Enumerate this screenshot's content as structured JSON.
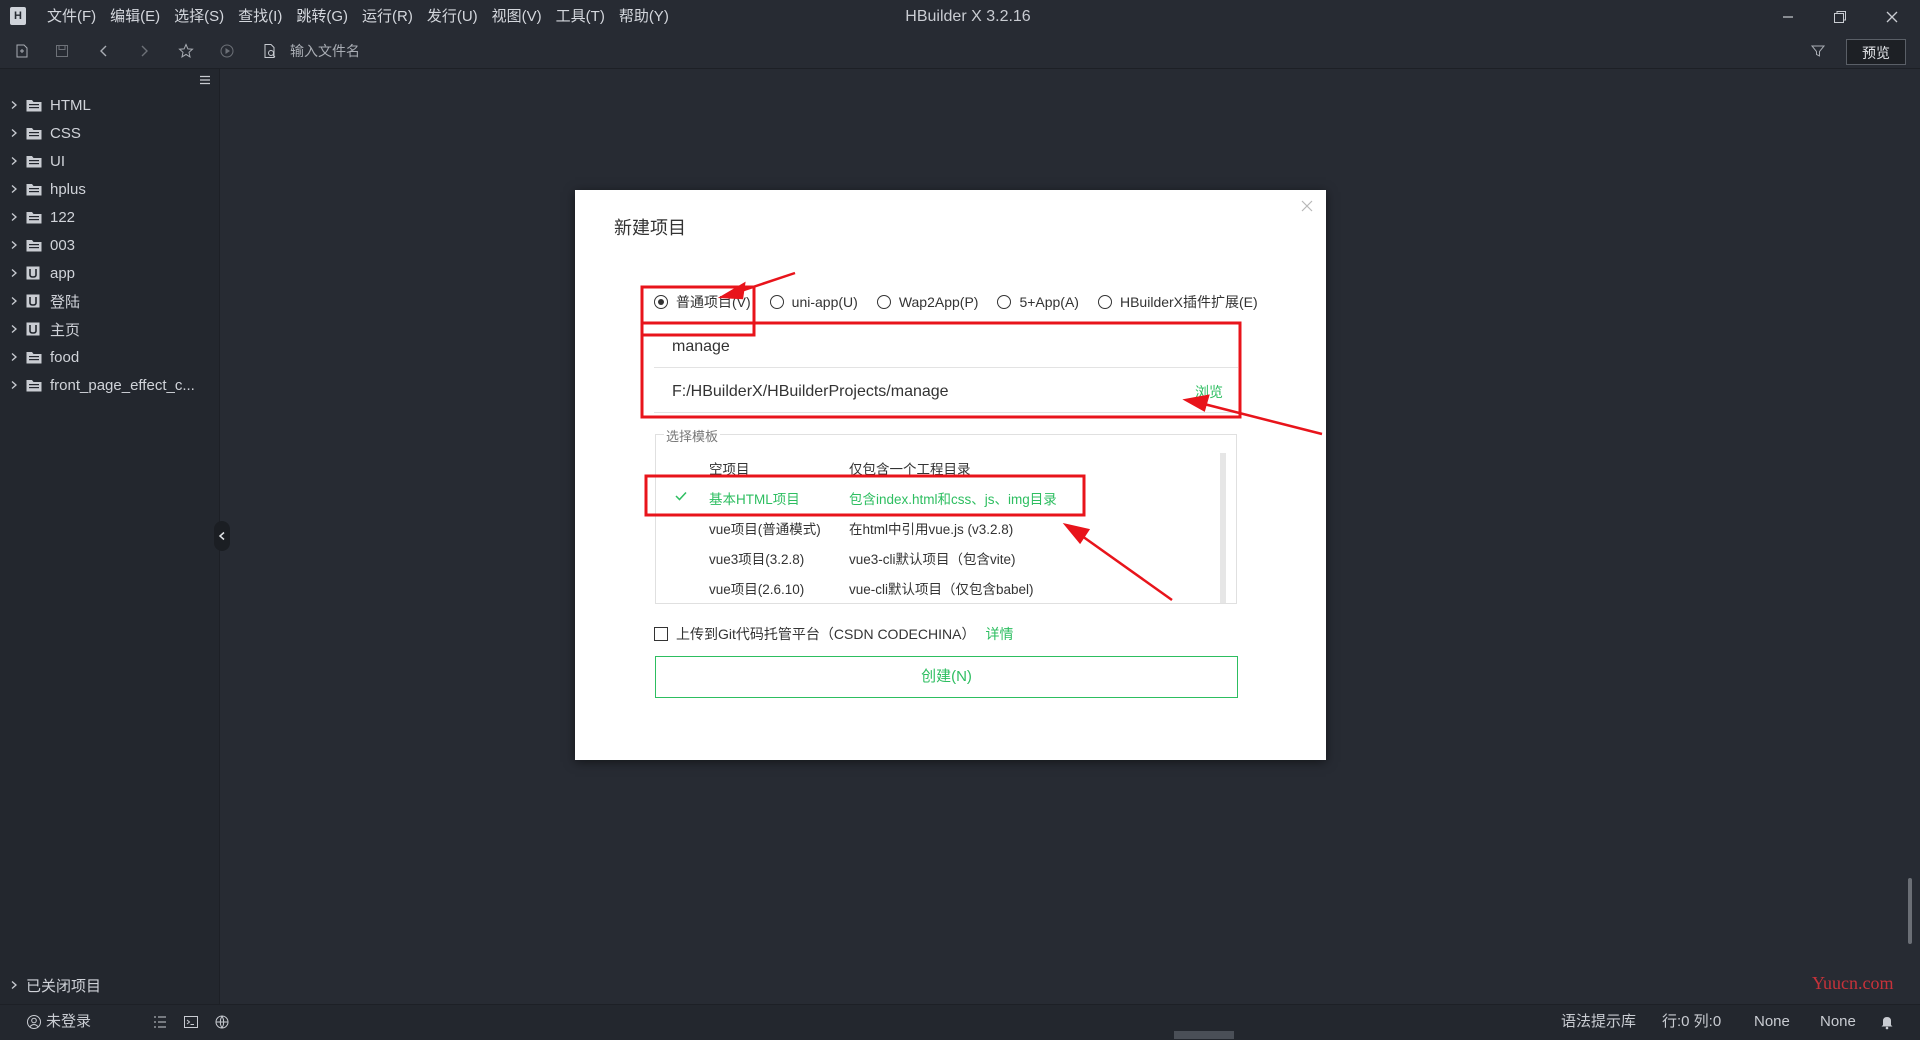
{
  "window": {
    "title": "HBuilder X 3.2.16",
    "logo_glyph": "H"
  },
  "menu": [
    {
      "label": "文件(F)"
    },
    {
      "label": "编辑(E)"
    },
    {
      "label": "选择(S)"
    },
    {
      "label": "查找(I)"
    },
    {
      "label": "跳转(G)"
    },
    {
      "label": "运行(R)"
    },
    {
      "label": "发行(U)"
    },
    {
      "label": "视图(V)"
    },
    {
      "label": "工具(T)"
    },
    {
      "label": "帮助(Y)"
    }
  ],
  "toolbar": {
    "file_search_placeholder": "输入文件名",
    "preview_label": "预览"
  },
  "sidebar": {
    "projects": [
      {
        "label": "HTML",
        "icon": "folder-icon"
      },
      {
        "label": "CSS",
        "icon": "folder-icon"
      },
      {
        "label": "UI",
        "icon": "folder-icon"
      },
      {
        "label": "hplus",
        "icon": "folder-icon"
      },
      {
        "label": "122",
        "icon": "folder-icon"
      },
      {
        "label": "003",
        "icon": "folder-icon"
      },
      {
        "label": "app",
        "icon": "uniapp-icon"
      },
      {
        "label": "登陆",
        "icon": "uniapp-icon"
      },
      {
        "label": "主页",
        "icon": "uniapp-icon"
      },
      {
        "label": "food",
        "icon": "folder-icon"
      },
      {
        "label": "front_page_effect_c...",
        "icon": "folder-icon"
      }
    ],
    "closed_projects_label": "已关闭项目"
  },
  "statusbar": {
    "login": "未登录",
    "syntax_lib": "语法提示库",
    "position": "行:0  列:0",
    "encoding": "None",
    "language": "None"
  },
  "watermark": "Yuucn.com",
  "dialog": {
    "title": "新建项目",
    "project_types": [
      {
        "label": "普通项目(V)",
        "checked": true
      },
      {
        "label": "uni-app(U)",
        "checked": false
      },
      {
        "label": "Wap2App(P)",
        "checked": false
      },
      {
        "label": "5+App(A)",
        "checked": false
      },
      {
        "label": "HBuilderX插件扩展(E)",
        "checked": false
      }
    ],
    "project_name": "manage",
    "project_path": "F:/HBuilderX/HBuilderProjects/manage",
    "browse_label": "浏览",
    "template_legend": "选择模板",
    "templates": [
      {
        "name": "空项目",
        "desc": "仅包含一个工程目录",
        "selected": false
      },
      {
        "name": "基本HTML项目",
        "desc": "包含index.html和css、js、img目录",
        "selected": true
      },
      {
        "name": "vue项目(普通模式)",
        "desc": "在html中引用vue.js (v3.2.8)",
        "selected": false
      },
      {
        "name": "vue3项目(3.2.8)",
        "desc": "vue3-cli默认项目（包含vite)",
        "selected": false
      },
      {
        "name": "vue项目(2.6.10)",
        "desc": "vue-cli默认项目（仅包含babel)",
        "selected": false
      }
    ],
    "git_upload_label": "上传到Git代码托管平台（CSDN CODECHINA）",
    "git_details_label": "详情",
    "create_label": "创建(N)"
  },
  "colors": {
    "background": "#272b33",
    "sidebar": "#23272e",
    "accent_green": "#2dbe60",
    "annotation_red": "#e8141b"
  }
}
